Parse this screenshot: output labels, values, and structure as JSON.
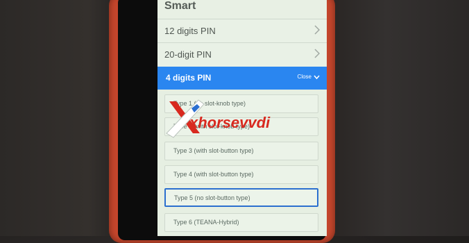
{
  "header": {
    "title": "Smart"
  },
  "menu": {
    "items": [
      {
        "label": "12 digits PIN"
      },
      {
        "label": "20-digit PIN"
      }
    ],
    "expanded": {
      "label": "4 digits PIN",
      "close_label": "Close"
    },
    "types": [
      {
        "label": "Type 1 (no slot-knob type)"
      },
      {
        "label": "Type 2 (with slot-knob type)"
      },
      {
        "label": "Type 3 (with slot-button type)"
      },
      {
        "label": "Type 4 (with slot-button type)"
      },
      {
        "label": "Type 5 (no slot-button type)"
      },
      {
        "label": "Type 6 (TEANA-Hybrid)"
      }
    ],
    "selected_index": 4
  },
  "watermark": {
    "text": "xhorsevvdi"
  },
  "colors": {
    "accent": "#2a86f0",
    "case": "#c5462c",
    "watermark": "#d8291f"
  }
}
